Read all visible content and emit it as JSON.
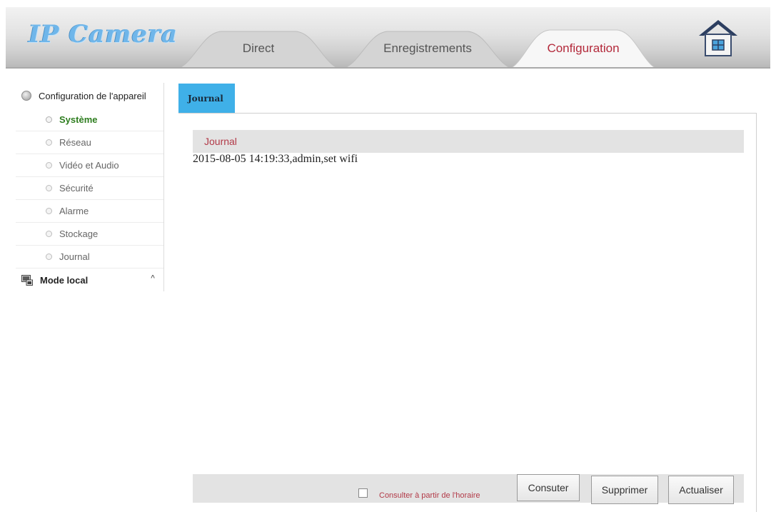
{
  "header": {
    "logo": "IP Camera",
    "tabs": [
      {
        "label": "Direct"
      },
      {
        "label": "Enregistrements"
      },
      {
        "label": "Configuration"
      }
    ]
  },
  "sidebar": {
    "group_label": "Configuration de l'appareil",
    "items": [
      {
        "label": "Système"
      },
      {
        "label": "Réseau"
      },
      {
        "label": "Vidéo et Audio"
      },
      {
        "label": "Sécurité"
      },
      {
        "label": "Alarme"
      },
      {
        "label": "Stockage"
      },
      {
        "label": "Journal"
      }
    ],
    "local_label": "Mode local",
    "local_caret": "^"
  },
  "main": {
    "tab_label": "Journal",
    "log_header": "Journal",
    "log_entries": [
      "2015-08-05 14:19:33,admin,set wifi"
    ]
  },
  "footer": {
    "checkbox_label": "Consulter à partir de l'horaire",
    "buttons": {
      "consult": "Consuter",
      "delete": "Supprimer",
      "refresh": "Actualiser"
    }
  },
  "colors": {
    "accent_tab": "#3fb0e8",
    "active_tab_text": "#b3293a",
    "active_menu_text": "#2e7d1f"
  }
}
